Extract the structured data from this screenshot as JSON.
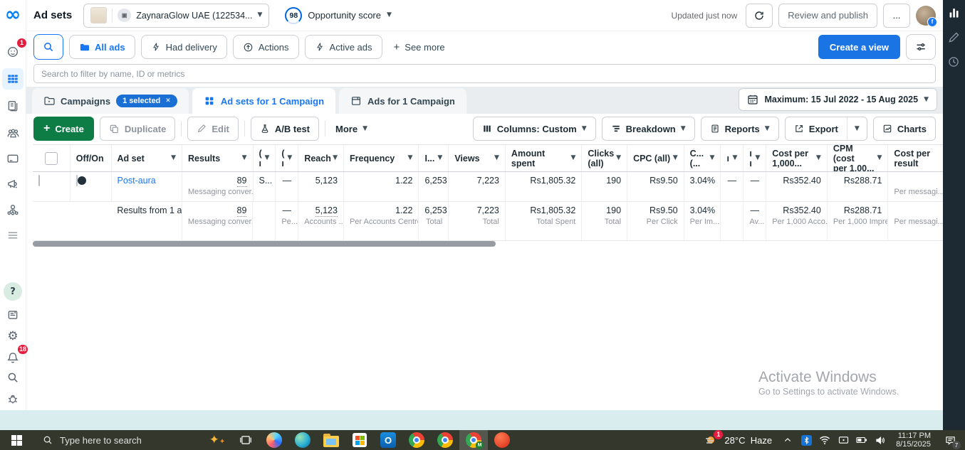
{
  "header": {
    "title": "Ad sets",
    "account_name": "ZaynaraGlow UAE (122534...",
    "score_value": "98",
    "score_label": "Opportunity score",
    "updated": "Updated just now",
    "review": "Review and publish",
    "more": "..."
  },
  "filters": {
    "all_ads": "All ads",
    "had_delivery": "Had delivery",
    "actions": "Actions",
    "active_ads": "Active ads",
    "see_more": "See more",
    "create_view": "Create a view"
  },
  "search_placeholder": "Search to filter by name, ID or metrics",
  "tabs": {
    "campaigns": "Campaigns",
    "badge": "1 selected",
    "adsets": "Ad sets for 1 Campaign",
    "ads": "Ads for 1 Campaign",
    "date_range": "Maximum: 15 Jul 2022 - 15 Aug 2025"
  },
  "toolbar": {
    "create": "Create",
    "duplicate": "Duplicate",
    "edit": "Edit",
    "ab_test": "A/B test",
    "more": "More",
    "columns": "Columns: Custom",
    "breakdown": "Breakdown",
    "reports": "Reports",
    "export": "Export",
    "charts": "Charts"
  },
  "table": {
    "headers": {
      "off_on": "Off/On",
      "ad_set": "Ad set",
      "results": "Results",
      "cut1a": "(",
      "cut1b": "ı",
      "cut2a": "(",
      "cut2b": "ı",
      "reach": "Reach",
      "frequency": "Frequency",
      "impressions": "I...",
      "views": "Views",
      "amount_spent": "Amount spent",
      "clicks_a": "Clicks",
      "clicks_b": "(all)",
      "cpc": "CPC (all)",
      "ctr_a": "C...",
      "ctr_b": "(...",
      "cut3": "ı",
      "cut4a": "ı",
      "cut4b": "ı",
      "cost1000_a": "Cost per",
      "cost1000_b": "1,000...",
      "cpm_a": "CPM (cost",
      "cpm_b": "per 1,00...",
      "cpr_a": "Cost per",
      "cpr_b": "result"
    },
    "row": {
      "name": "Post-aura",
      "results": "89",
      "results_sub": "Messaging conver...",
      "cut1": "S...",
      "cut2": "—",
      "reach": "5,123",
      "frequency": "1.22",
      "impressions": "6,253",
      "views": "7,223",
      "spent": "Rs1,805.32",
      "clicks": "190",
      "cpc": "Rs9.50",
      "ctr": "3.04%",
      "cut3": "—",
      "cut4": "—",
      "cost1000": "Rs352.40",
      "cpm": "Rs288.71",
      "cpr_sub": "Per messagi..."
    },
    "summary": {
      "label": "Results from 1 a",
      "results": "89",
      "results_sub": "Messaging conver...",
      "cut2": "—",
      "cut2_sub": "Pe...",
      "reach": "5,123",
      "reach_sub": "Accounts ...",
      "frequency": "1.22",
      "frequency_sub": "Per Accounts Centre...",
      "impressions": "6,253",
      "impressions_sub": "Total",
      "views": "7,223",
      "views_sub": "Total",
      "spent": "Rs1,805.32",
      "spent_sub": "Total Spent",
      "clicks": "190",
      "clicks_sub": "Total",
      "cpc": "Rs9.50",
      "cpc_sub": "Per Click",
      "ctr": "3.04%",
      "ctr_sub": "Per Im...",
      "cut4": "—",
      "cut4_sub": "Av...",
      "cost1000": "Rs352.40",
      "cost1000_sub": "Per 1,000 Acco...",
      "cpm": "Rs288.71",
      "cpm_sub": "Per 1,000 Impre...",
      "cpr_sub": "Per messagi..."
    }
  },
  "sidebar": {
    "top_badge": "1",
    "bell_badge": "18"
  },
  "watermark": {
    "line1": "Activate Windows",
    "line2": "Go to Settings to activate Windows."
  },
  "taskbar": {
    "search_placeholder": "Type here to search",
    "temp": "28°C",
    "condition": "Haze",
    "weather_badge": "1",
    "time": "11:17 PM",
    "date": "8/15/2025",
    "notif_badge": "7"
  },
  "colors": {
    "accent_blue": "#1877f2",
    "create_green": "#0d7d45",
    "badge_red": "#e41e3f"
  }
}
